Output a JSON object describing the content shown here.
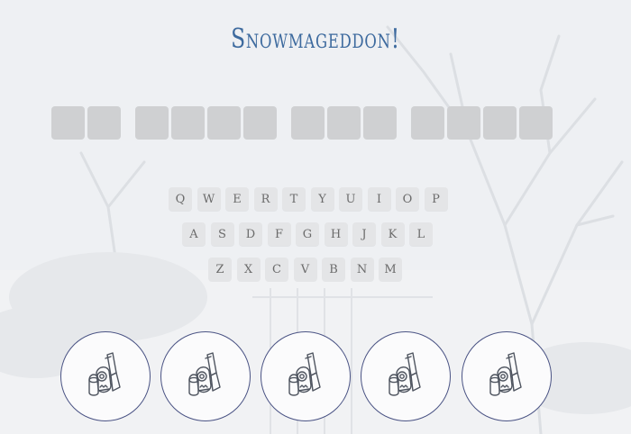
{
  "game": {
    "title": "Snowmageddon!",
    "accent_color": "#3d6a9e",
    "tile_color": "#cfd0d2",
    "life_border_color": "#4a5384"
  },
  "puzzle": {
    "words": [
      {
        "length": 2
      },
      {
        "length": 4
      },
      {
        "length": 3
      },
      {
        "length": 4
      }
    ],
    "revealed_letters": []
  },
  "keyboard": {
    "rows": [
      [
        "Q",
        "W",
        "E",
        "R",
        "T",
        "Y",
        "U",
        "I",
        "O",
        "P"
      ],
      [
        "A",
        "S",
        "D",
        "F",
        "G",
        "H",
        "J",
        "K",
        "L"
      ],
      [
        "Z",
        "X",
        "C",
        "V",
        "B",
        "N",
        "M"
      ]
    ]
  },
  "lives": {
    "count": 5,
    "icon": "winter-gear-icon"
  }
}
